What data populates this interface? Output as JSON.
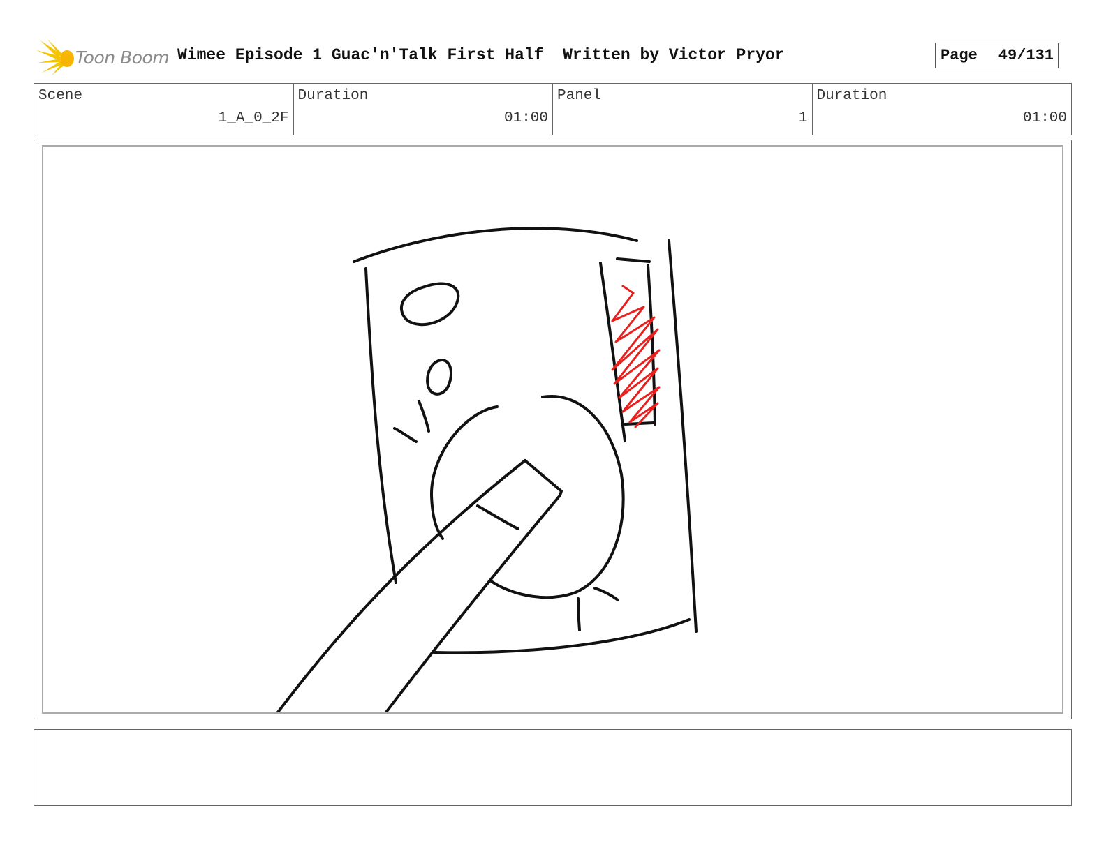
{
  "header": {
    "logo_text": "Toon Boom",
    "title": "Wimee Episode 1 Guac'n'Talk First Half  Written by Victor Pryor",
    "page_label": "Page",
    "page_value": "49/131"
  },
  "info": {
    "scene_label": "Scene",
    "scene_value": "1_A_0_2F",
    "scene_duration_label": "Duration",
    "scene_duration_value": "01:00",
    "panel_label": "Panel",
    "panel_value": "1",
    "panel_duration_label": "Duration",
    "panel_duration_value": "01:00"
  },
  "notes": {
    "text": ""
  },
  "colors": {
    "logo_accent": "#f5c400",
    "sketch_line": "#111111",
    "scribble": "#e8201e"
  },
  "icons": {
    "logo": "toon-boom-burst-icon"
  }
}
